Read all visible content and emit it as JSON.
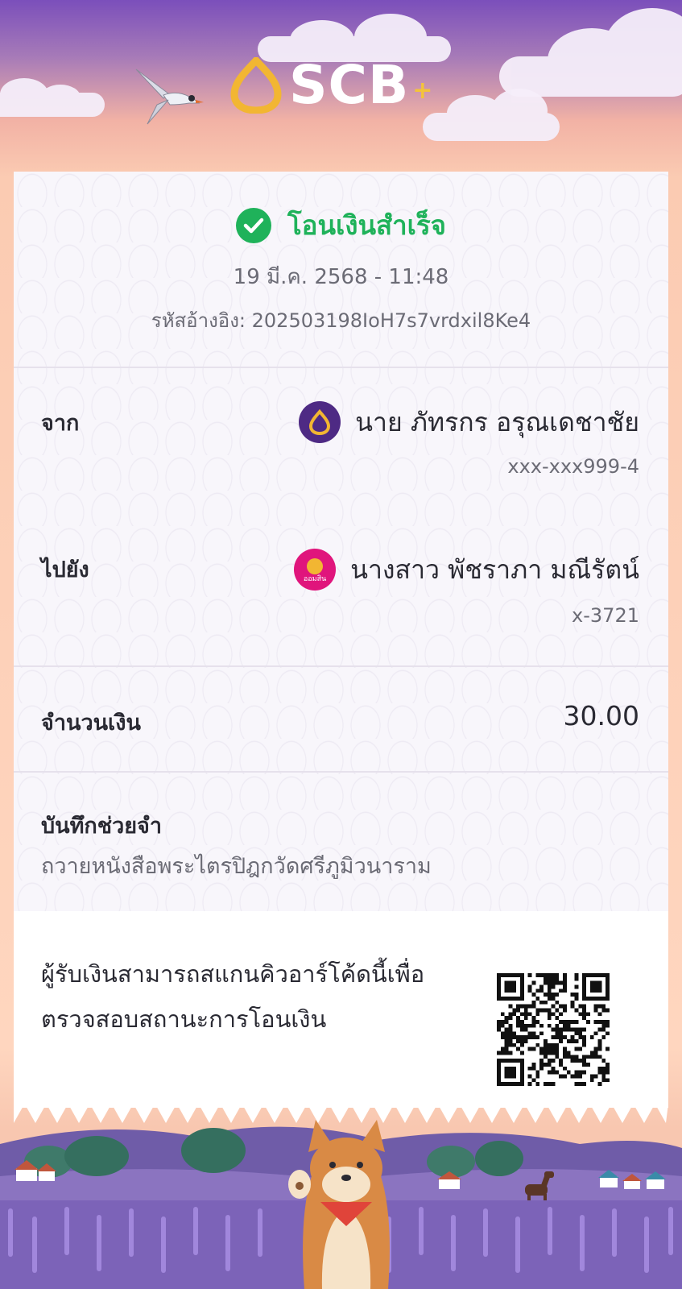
{
  "header": {
    "brand": "SCB",
    "brand_plus": "+",
    "logo_icon": "scb-shell-logo-icon",
    "bird_icon": "bird-icon"
  },
  "status": {
    "icon": "check-circle-icon",
    "text": "โอนเงินสำเร็จ",
    "color": "#1fb25a"
  },
  "datetime": "19 มี.ค. 2568 - 11:48",
  "reference": "รหัสอ้างอิง: 202503198IoH7s7vrdxil8Ke4",
  "from": {
    "label": "จาก",
    "bank_icon": "scb-bank-icon",
    "name": "นาย ภัทรกร อรุณเดชาชัย",
    "account": "xxx-xxx999-4"
  },
  "to": {
    "label": "ไปยัง",
    "bank_icon": "gsb-bank-icon",
    "bank_badge": "ออมสิน",
    "name": "นางสาว พัชราภา มณีรัตน์",
    "account": "x-3721"
  },
  "amount": {
    "label": "จำนวนเงิน",
    "value": "30.00"
  },
  "memo": {
    "label": "บันทึกช่วยจำ",
    "value": "ถวายหนังสือพระไตรปิฎกวัดศรีภูมิวนาราม"
  },
  "qr": {
    "line1": "ผู้รับเงินสามารถสแกนคิวอาร์โค้ดนี้เพื่อ",
    "line2": "ตรวจสอบสถานะการโอนเงิน",
    "icon": "qr-code"
  },
  "colors": {
    "brand_purple": "#4e2a84",
    "success_green": "#1fb25a",
    "sky_top": "#7b4fbb",
    "sky_bottom": "#ffd6bf"
  }
}
